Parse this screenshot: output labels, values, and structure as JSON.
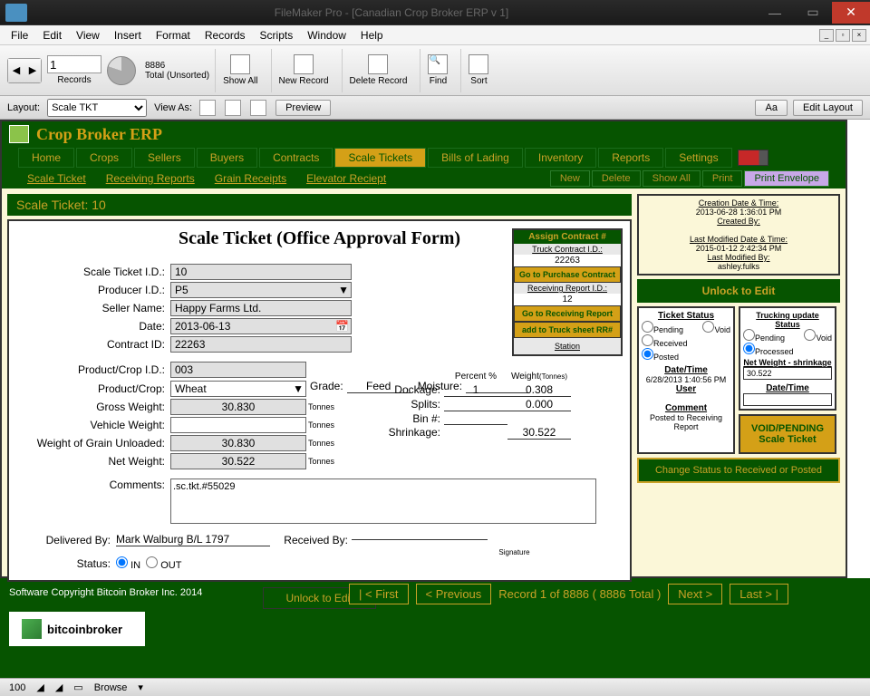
{
  "window": {
    "title": "FileMaker Pro - [Canadian Crop Broker ERP v 1]"
  },
  "menu": [
    "File",
    "Edit",
    "View",
    "Insert",
    "Format",
    "Records",
    "Scripts",
    "Window",
    "Help"
  ],
  "toolbar": {
    "record_num": "1",
    "records_label": "Records",
    "total_count": "8886",
    "total_label": "Total (Unsorted)",
    "buttons": [
      "Show All",
      "New Record",
      "Delete Record",
      "Find",
      "Sort"
    ]
  },
  "layoutbar": {
    "layout_label": "Layout:",
    "layout_value": "Scale TKT",
    "viewas_label": "View As:",
    "preview": "Preview",
    "aa": "Aa",
    "edit": "Edit Layout"
  },
  "erp": {
    "title": "Crop Broker ERP",
    "nav": [
      "Home",
      "Crops",
      "Sellers",
      "Buyers",
      "Contracts",
      "Scale Tickets",
      "Bills of Lading",
      "Inventory",
      "Reports",
      "Settings"
    ],
    "active_nav": "Scale Tickets",
    "subnav_links": [
      "Scale Ticket",
      "Receiving Reports",
      "Grain Receipts",
      "Elevator Reciept"
    ],
    "subnav_btns": [
      "New",
      "Delete",
      "Show All",
      "Print",
      "Print Envelope"
    ],
    "section_title": "Scale Ticket: 10",
    "form_title": "Scale Ticket  (Office Approval Form)"
  },
  "form": {
    "scale_ticket_id_lbl": "Scale Ticket I.D.:",
    "scale_ticket_id": "10",
    "producer_id_lbl": "Producer I.D.:",
    "producer_id": "P5",
    "seller_name_lbl": "Seller Name:",
    "seller_name": "Happy Farms Ltd.",
    "date_lbl": "Date:",
    "date": "2013-06-13",
    "contract_id_lbl": "Contract ID:",
    "contract_id": "22263",
    "product_crop_id_lbl": "Product/Crop I.D.:",
    "product_crop_id": "003",
    "product_crop_lbl": "Product/Crop:",
    "product_crop": "Wheat",
    "grade_lbl": "Grade:",
    "grade": "Feed",
    "moisture_lbl": "Moisture:",
    "moisture": "",
    "gross_weight_lbl": "Gross Weight:",
    "gross_weight": "30.830",
    "unit": "Tonnes",
    "vehicle_weight_lbl": "Vehicle Weight:",
    "vehicle_weight": "",
    "grain_unloaded_lbl": "Weight of Grain Unloaded:",
    "grain_unloaded": "30.830",
    "net_weight_lbl": "Net Weight:",
    "net_weight": "30.522",
    "percent_lbl": "Percent %",
    "weight_lbl": "Weight",
    "weight_unit": "(Tonnes)",
    "dockage_lbl": "Dockage:",
    "dockage_pct": "1",
    "dockage_wt": "0.308",
    "splits_lbl": "Splits:",
    "splits_pct": "",
    "splits_wt": "0.000",
    "bin_lbl": "Bin #:",
    "bin": "",
    "shrinkage_lbl": "Shrinkage:",
    "shrinkage": "30.522",
    "comments_lbl": "Comments:",
    "comments": ".sc.tkt.#55029",
    "delivered_by_lbl": "Delivered By:",
    "delivered_by": "Mark Walburg B/L 1797",
    "received_by_lbl": "Received By:",
    "signature_lbl": "Signature",
    "status_lbl": "Status:",
    "status_in": "IN",
    "status_out": "OUT"
  },
  "assign": {
    "header": "Assign Contract #",
    "tcid_lbl": "Truck Contract I.D.:",
    "tcid": "22263",
    "go_purchase": "Go to Purchase Contract",
    "rrid_lbl": "Receiving Report I.D.:",
    "rrid": "12",
    "go_receiving": "Go to Receiving Report",
    "add_truck": "add to Truck sheet RR#",
    "station": "Station"
  },
  "meta": {
    "created_lbl": "Creation Date & Time:",
    "created": "2013-06-28 1:36:01 PM",
    "createdby_lbl": "Created By:",
    "createdby": "",
    "modified_lbl": "Last Modified Date & Time:",
    "modified": "2015-01-12 2:42:34 PM",
    "modifiedby_lbl": "Last Modified By:",
    "modifiedby": "ashley.fulks",
    "unlock": "Unlock to Edit"
  },
  "status": {
    "ts_header": "Ticket Status",
    "pending": "Pending",
    "void": "Void",
    "received": "Received",
    "posted": "Posted",
    "dt_lbl": "Date/Time",
    "dt": "6/28/2013 1:40:56 PM",
    "user": "User",
    "comment_lbl": "Comment",
    "comment": "Posted to Receiving Report",
    "tu_header": "Trucking update Status",
    "processed": "Processed",
    "nw_lbl": "Net Weight - shrinkage",
    "nw": "30.522",
    "void_btn": "VOID/PENDING Scale Ticket",
    "change_btn": "Change Status to Received or Posted"
  },
  "footer": {
    "unlock": "Unlock to Edit",
    "copyright": "Software Copyright Bitcoin Broker Inc. 2014",
    "first": "| <  First",
    "prev": "<  Previous",
    "record": "Record 1 of 8886 ( 8886 Total )",
    "next": "Next  >",
    "last": "Last  > |",
    "logo": "bitcoinbroker"
  },
  "statusbar": {
    "zoom": "100",
    "mode": "Browse"
  }
}
